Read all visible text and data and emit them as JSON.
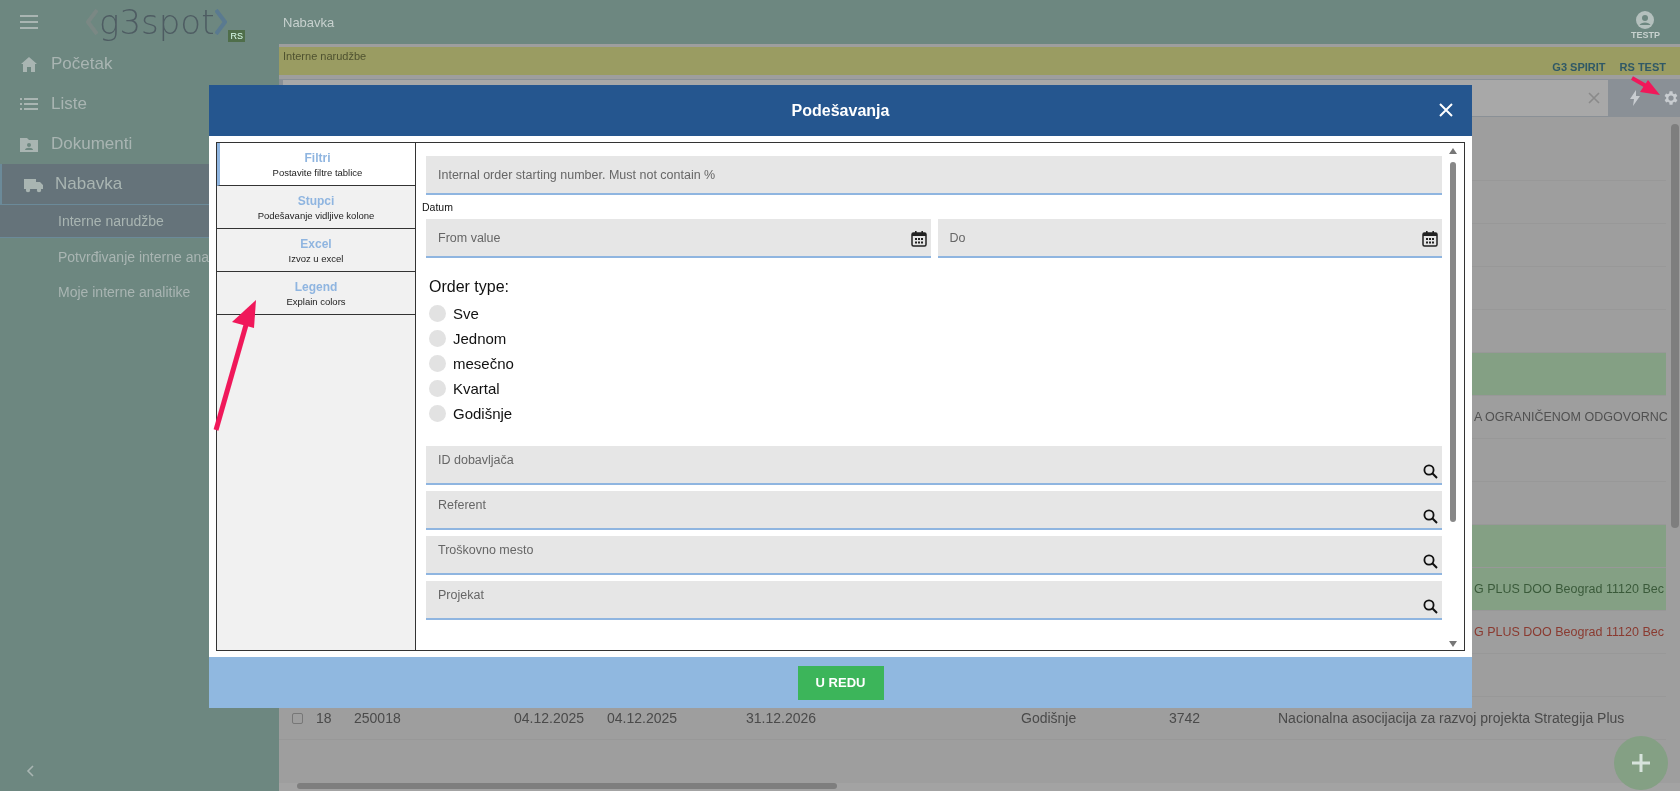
{
  "sidebar": {
    "logo": "g3spot",
    "logo_badge": "RS",
    "items": [
      {
        "label": "Početak",
        "selected": false
      },
      {
        "label": "Liste",
        "selected": false
      },
      {
        "label": "Dokumenti",
        "selected": false
      },
      {
        "label": "Nabavka",
        "selected": true,
        "children": [
          {
            "label": "Interne narudžbe",
            "selected": true
          },
          {
            "label": "Potvrđivanje interne ana",
            "selected": false
          },
          {
            "label": "Moje interne analitike",
            "selected": false
          }
        ]
      }
    ]
  },
  "header": {
    "title": "Nabavka",
    "user": "TESTP"
  },
  "context_bar": {
    "label": "Interne narudžbe",
    "company": [
      "G3 SPIRIT",
      "RS TEST"
    ]
  },
  "table": {
    "rows": [
      {
        "highlighted": false
      },
      {
        "highlighted": false
      },
      {
        "highlighted": false
      },
      {
        "highlighted": false
      },
      {
        "highlighted": false
      },
      {
        "highlighted": true
      },
      {
        "highlighted": false,
        "error": false,
        "text": "A OGRANIČENOM ODGOVORNC"
      },
      {
        "highlighted": false
      },
      {
        "highlighted": false
      },
      {
        "highlighted": true
      },
      {
        "highlighted": true,
        "error": false,
        "text": "G PLUS DOO Beograd 11120 Bec"
      },
      {
        "highlighted": false,
        "error": true,
        "text": "G PLUS DOO Beograd 11120 Bec"
      },
      {
        "highlighted": false
      },
      {
        "highlighted": false,
        "checked": false,
        "cells": [
          "18",
          "250018",
          "04.12.2025",
          "04.12.2025",
          "31.12.2026",
          "Godišnje",
          "3742",
          "Nacionalna asocijacija za razvoj projekta Strategija Plus"
        ]
      }
    ]
  },
  "dialog": {
    "title": "Podešavanja",
    "tabs": [
      {
        "title": "Filtri",
        "subtitle": "Postavite filtre tablice",
        "selected": true
      },
      {
        "title": "Stupci",
        "subtitle": "Podešavanje vidljive kolone",
        "selected": false
      },
      {
        "title": "Excel",
        "subtitle": "Izvoz u excel",
        "selected": false
      },
      {
        "title": "Legend",
        "subtitle": "Explain colors",
        "selected": false
      }
    ],
    "filters": [
      {
        "kind": "text",
        "placeholder": "Internal order starting number. Must not contain %"
      },
      {
        "kind": "date_range",
        "label": "Datum",
        "from_placeholder": "From value",
        "to_placeholder": "Do"
      },
      {
        "kind": "radio",
        "label": "Order type:",
        "options": [
          {
            "label": "Sve",
            "selected": false
          },
          {
            "label": "Jednom",
            "selected": false
          },
          {
            "label": "mesečno",
            "selected": false
          },
          {
            "label": "Kvartal",
            "selected": false
          },
          {
            "label": "Godišnje",
            "selected": false
          }
        ]
      },
      {
        "kind": "lookup",
        "placeholder": "ID dobavljača"
      },
      {
        "kind": "lookup",
        "placeholder": "Referent"
      },
      {
        "kind": "lookup",
        "placeholder": "Troškovno mesto"
      },
      {
        "kind": "lookup",
        "placeholder": "Projekat"
      }
    ],
    "ok_button": "U REDU"
  }
}
